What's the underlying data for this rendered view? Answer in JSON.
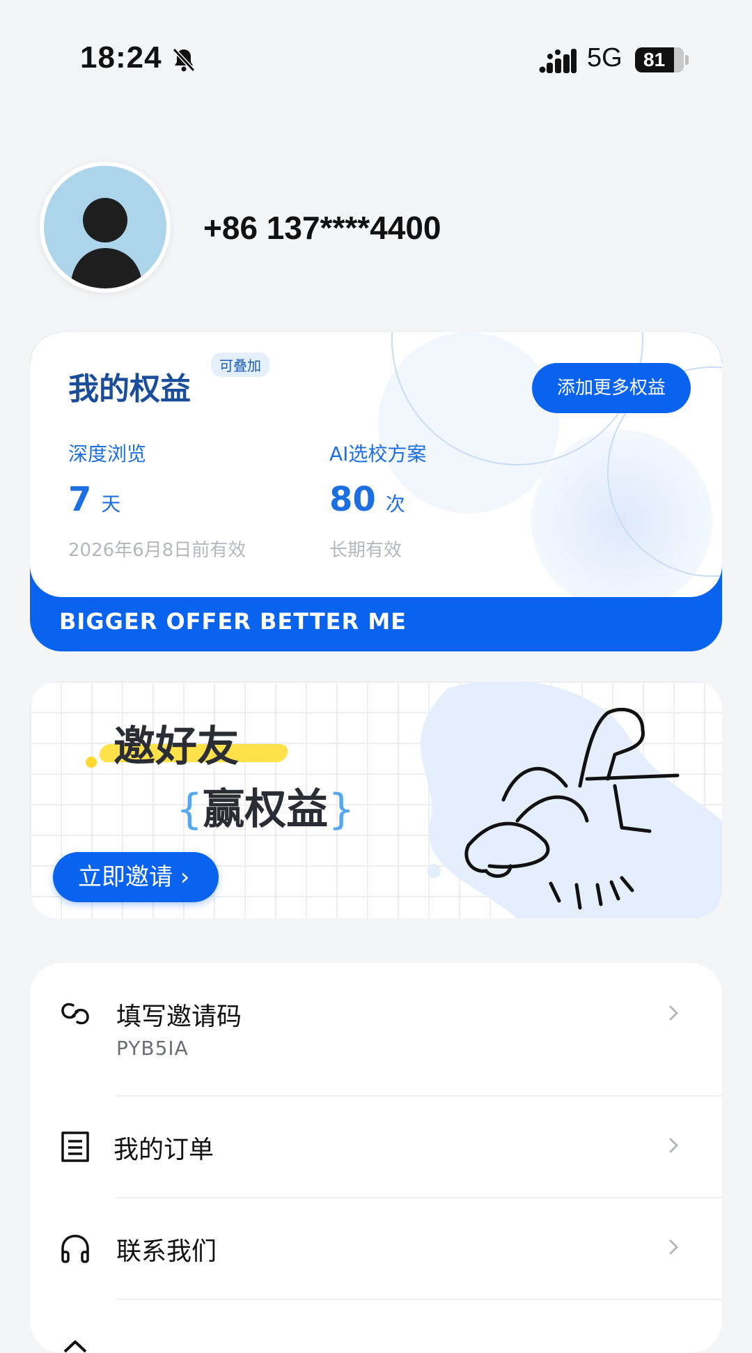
{
  "status_bar": {
    "time": "18:24",
    "network": "5G",
    "battery": "81"
  },
  "profile": {
    "phone": "+86 137****4400"
  },
  "benefits": {
    "title": "我的权益",
    "tag": "可叠加",
    "add_button": "添加更多权益",
    "items": [
      {
        "label": "深度浏览",
        "value": "7",
        "unit": "天",
        "note": "2026年6月8日前有效"
      },
      {
        "label": "AI选校方案",
        "value": "80",
        "unit": "次",
        "note": "长期有效"
      }
    ],
    "slogan": "BIGGER OFFER  BETTER ME"
  },
  "invite_banner": {
    "line1": "邀好友",
    "line2": "赢权益",
    "brace_open": "{",
    "brace_close": "}",
    "button": "立即邀请 ›"
  },
  "menu": [
    {
      "label": "填写邀请码",
      "sub": "PYB5IA",
      "icon": "link-icon"
    },
    {
      "label": "我的订单",
      "icon": "receipt-icon"
    },
    {
      "label": "联系我们",
      "icon": "headphones-icon"
    }
  ]
}
